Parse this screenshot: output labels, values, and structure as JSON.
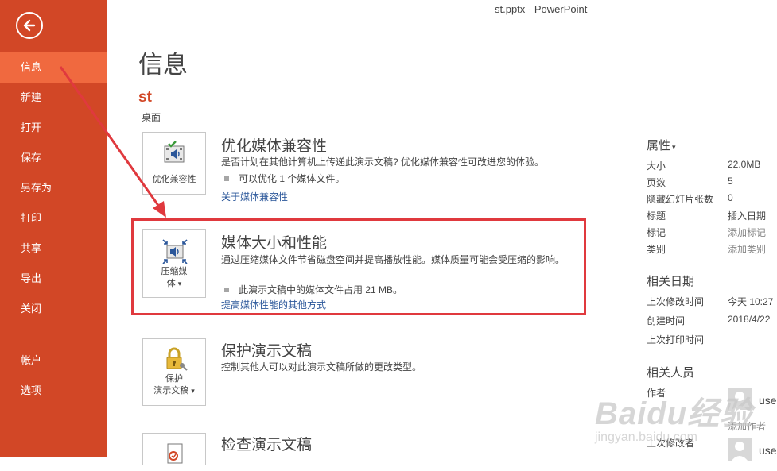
{
  "window": {
    "title": "st.pptx - PowerPoint"
  },
  "sidebar": {
    "back_icon": "back-arrow-icon",
    "items": [
      {
        "label": "信息",
        "active": true
      },
      {
        "label": "新建"
      },
      {
        "label": "打开"
      },
      {
        "label": "保存"
      },
      {
        "label": "另存为"
      },
      {
        "label": "打印"
      },
      {
        "label": "共享"
      },
      {
        "label": "导出"
      },
      {
        "label": "关闭"
      }
    ],
    "bottom_items": [
      {
        "label": "帐户"
      },
      {
        "label": "选项"
      }
    ]
  },
  "main": {
    "title": "信息",
    "file_name": "st",
    "file_location": "桌面",
    "sections": [
      {
        "icon": "film-speaker-check-icon",
        "tile_label": "优化兼容性",
        "title": "优化媒体兼容性",
        "description": "是否计划在其他计算机上传递此演示文稿? 优化媒体兼容性可改进您的体验。",
        "bullet": "可以优化 1 个媒体文件。",
        "link": "关于媒体兼容性"
      },
      {
        "icon": "compress-media-icon",
        "tile_label_line1": "压缩媒",
        "tile_label_line2": "体",
        "dropdown": "▾",
        "title": "媒体大小和性能",
        "description": "通过压缩媒体文件节省磁盘空间并提高播放性能。媒体质量可能会受压缩的影响。",
        "bullet": "此演示文稿中的媒体文件占用 21 MB。",
        "link": "提高媒体性能的其他方式"
      },
      {
        "icon": "lock-key-icon",
        "tile_label_line1": "保护",
        "tile_label_line2": "演示文稿",
        "dropdown": "▾",
        "title": "保护演示文稿",
        "description": "控制其他人可以对此演示文稿所做的更改类型。"
      },
      {
        "icon": "inspect-document-icon",
        "title": "检查演示文稿"
      }
    ]
  },
  "properties": {
    "heading": "属性",
    "heading_dropdown": "▾",
    "rows": [
      {
        "label": "大小",
        "value": "22.0MB"
      },
      {
        "label": "页数",
        "value": "5"
      },
      {
        "label": "隐藏幻灯片张数",
        "value": "0"
      },
      {
        "label": "标题",
        "value": "插入日期"
      },
      {
        "label": "标记",
        "value": "添加标记",
        "muted": true
      },
      {
        "label": "类别",
        "value": "添加类别",
        "muted": true
      }
    ],
    "related_dates": {
      "heading": "相关日期",
      "rows": [
        {
          "label": "上次修改时间",
          "value": "今天 10:27"
        },
        {
          "label": "创建时间",
          "value": "2018/4/22"
        },
        {
          "label": "上次打印时间",
          "value": ""
        }
      ]
    },
    "related_people": {
      "heading": "相关人员",
      "author_label": "作者",
      "author_name": "use",
      "add_author": "添加作者",
      "last_modified_label": "上次修改者",
      "last_modified_name": "use"
    }
  },
  "annotation": {
    "highlight_color": "#e0393e",
    "arrow_color": "#e0393e"
  },
  "watermark": {
    "main": "Baidu经验",
    "sub": "jingyan.baidu.com"
  },
  "colors": {
    "sidebar": "#d24726",
    "sidebar_active": "#f0693f",
    "accent": "#d24726",
    "link": "#2b579a"
  }
}
